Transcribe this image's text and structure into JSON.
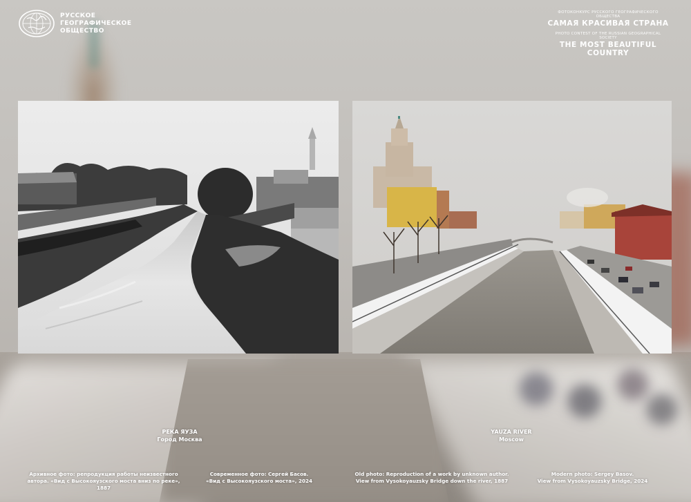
{
  "organization": {
    "name_lines": [
      "РУССКОЕ",
      "ГЕОГРАФИЧЕСКОЕ",
      "ОБЩЕСТВО"
    ],
    "logo_icon": "globe-emblem-icon"
  },
  "contest": {
    "subtitle_ru": "ФОТОКОНКУРС РУССКОГО ГЕОГРАФИЧЕСКОГО ОБЩЕСТВА",
    "title_ru": "САМАЯ КРАСИВАЯ СТРАНА",
    "subtitle_en": "PHOTO CONTEST OF THE RUSSIAN GEOGRAPHICAL SOCIETY",
    "title_en": "THE MOST BEAUTIFUL COUNTRY"
  },
  "caption_ru": {
    "title": "РЕКА ЯУЗА",
    "place": "Город Москва"
  },
  "caption_en": {
    "title": "YAUZA RIVER",
    "place": "Moscow"
  },
  "credits": {
    "archive_ru": [
      "Архивное фото: репродукция работы неизвестного",
      "автора. «Вид с Высокояузского моста вниз по реке», 1887"
    ],
    "modern_ru": [
      "Современное фото: Сергей Басов.",
      "«Вид с Высокояузского моста», 2024"
    ],
    "archive_en": [
      "Old photo: Reproduction of a work by unknown author.",
      "View from Vysokoyauzsky Bridge down the river, 1887"
    ],
    "modern_en": [
      "Modern photo: Sergey Basov.",
      "View from Vysokoyauzsky Bridge, 2024"
    ]
  },
  "colors": {
    "accent_red_building": "#a8443a",
    "yellow_building": "#d8b548"
  }
}
